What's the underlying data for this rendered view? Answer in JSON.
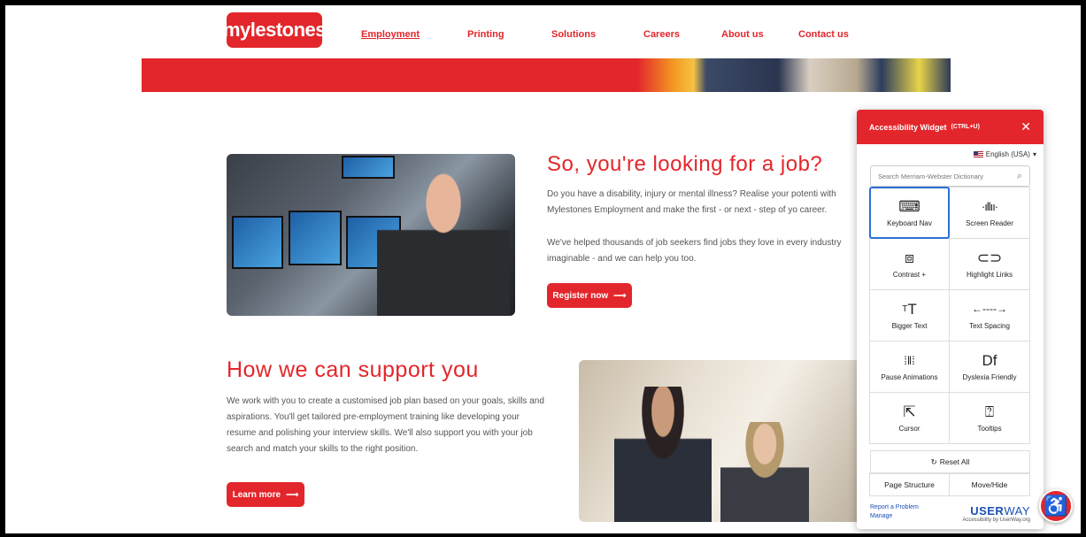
{
  "nav": {
    "logo": "mylestones",
    "links": [
      "Employment",
      "Printing",
      "Solutions",
      "Careers",
      "About us",
      "Contact us"
    ]
  },
  "section1": {
    "title": "So, you're looking for a job?",
    "para1": "Do you have a disability, injury or mental illness? Realise your potenti with Mylestones Employment and make the first - or next - step of yo career.",
    "para2": "We've helped thousands of job seekers find jobs they love in every industry imaginable - and we can help you too.",
    "button": "Register now"
  },
  "section2": {
    "title": "How we can support you",
    "para": "We work with you to create a customised job plan based on your goals, skills and aspirations. You'll get tailored pre-employment training like developing your resume and polishing your interview skills. We'll also support you with your job search and match your skills to the right position.",
    "button": "Learn more"
  },
  "widget": {
    "title": "Accessibility Widget",
    "shortcut": "(CTRL+U)",
    "language": "English (USA)",
    "search_placeholder": "Search Merriam-Webster Dictionary",
    "tiles": [
      {
        "label": "Keyboard Nav",
        "icon": "keyboard-icon"
      },
      {
        "label": "Screen Reader",
        "icon": "sound-wave-icon"
      },
      {
        "label": "Contrast +",
        "icon": "contrast-icon"
      },
      {
        "label": "Highlight Links",
        "icon": "link-icon"
      },
      {
        "label": "Bigger Text",
        "icon": "text-size-icon"
      },
      {
        "label": "Text Spacing",
        "icon": "spacing-arrows-icon"
      },
      {
        "label": "Pause Animations",
        "icon": "pause-icon"
      },
      {
        "label": "Dyslexia Friendly",
        "icon": "df-icon"
      },
      {
        "label": "Cursor",
        "icon": "cursor-icon"
      },
      {
        "label": "Tooltips",
        "icon": "tooltip-icon"
      }
    ],
    "reset": "Reset All",
    "page_structure": "Page Structure",
    "move_hide": "Move/Hide",
    "report": "Report a Problem",
    "manage": "Manage",
    "brand_bold": "USER",
    "brand_light": "WAY",
    "brand_sub": "Accessibility by UserWay.org"
  },
  "colors": {
    "brand": "#e3262b",
    "link": "#1b4fb6",
    "selected": "#2a6fd6"
  }
}
